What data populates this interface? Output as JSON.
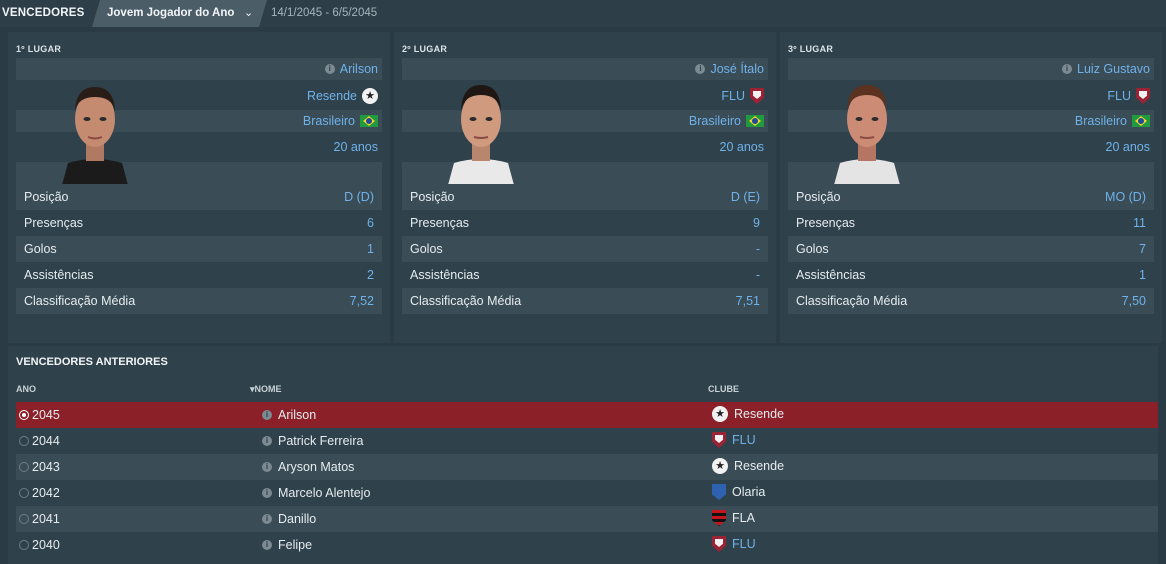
{
  "header": {
    "section": "VENCEDORES",
    "award": "Jovem Jogador do Ano",
    "dates": "14/1/2045 - 6/5/2045"
  },
  "podium": [
    {
      "place": "1º LUGAR",
      "name": "Arilson",
      "club": "Resende",
      "nationality": "Brasileiro",
      "age": "20 anos",
      "stats": [
        {
          "label": "Posição",
          "value": "D (D)"
        },
        {
          "label": "Presenças",
          "value": "6"
        },
        {
          "label": "Golos",
          "value": "1"
        },
        {
          "label": "Assistências",
          "value": "2"
        },
        {
          "label": "Classificação Média",
          "value": "7,52"
        }
      ]
    },
    {
      "place": "2º LUGAR",
      "name": "José Ítalo",
      "club": "FLU",
      "nationality": "Brasileiro",
      "age": "20 anos",
      "stats": [
        {
          "label": "Posição",
          "value": "D (E)"
        },
        {
          "label": "Presenças",
          "value": "9"
        },
        {
          "label": "Golos",
          "value": "-"
        },
        {
          "label": "Assistências",
          "value": "-"
        },
        {
          "label": "Classificação Média",
          "value": "7,51"
        }
      ]
    },
    {
      "place": "3º LUGAR",
      "name": "Luiz Gustavo",
      "club": "FLU",
      "nationality": "Brasileiro",
      "age": "20 anos",
      "stats": [
        {
          "label": "Posição",
          "value": "MO (D)"
        },
        {
          "label": "Presenças",
          "value": "11"
        },
        {
          "label": "Golos",
          "value": "7"
        },
        {
          "label": "Assistências",
          "value": "1"
        },
        {
          "label": "Classificação Média",
          "value": "7,50"
        }
      ]
    }
  ],
  "previous": {
    "title": "VENCEDORES ANTERIORES",
    "col_year": "ANO",
    "col_name": "NOME",
    "col_club": "CLUBE",
    "rows": [
      {
        "year": "2045",
        "name": "Arilson",
        "club": "Resende"
      },
      {
        "year": "2044",
        "name": "Patrick Ferreira",
        "club": "FLU"
      },
      {
        "year": "2043",
        "name": "Aryson Matos",
        "club": "Resende"
      },
      {
        "year": "2042",
        "name": "Marcelo Alentejo",
        "club": "Olaria"
      },
      {
        "year": "2041",
        "name": "Danillo",
        "club": "FLA"
      },
      {
        "year": "2040",
        "name": "Felipe",
        "club": "FLU"
      }
    ]
  }
}
